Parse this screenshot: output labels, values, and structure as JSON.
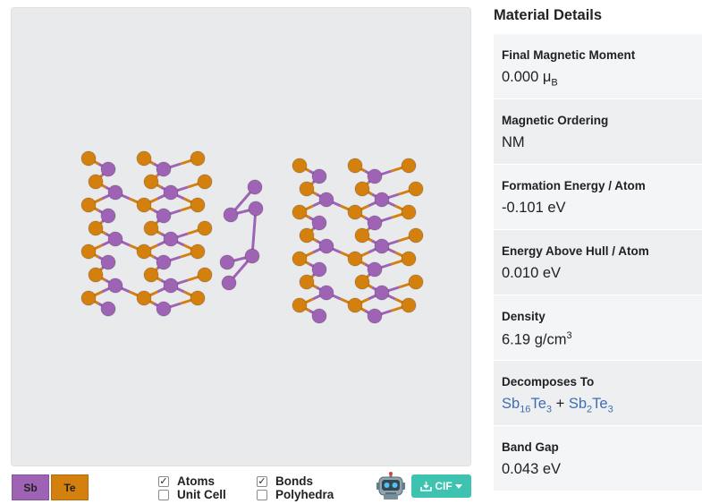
{
  "legend": {
    "sb": "Sb",
    "te": "Te"
  },
  "colors": {
    "sb": "#9e63b5",
    "te": "#d4800f",
    "cif_button": "#3ec3b1",
    "link": "#3f6eb3"
  },
  "toggles": {
    "atoms": {
      "label": "Atoms",
      "checked": true
    },
    "unit_cell": {
      "label": "Unit Cell",
      "checked": false
    },
    "bonds": {
      "label": "Bonds",
      "checked": true
    },
    "polyhedra": {
      "label": "Polyhedra",
      "checked": false
    }
  },
  "download": {
    "label": "CIF",
    "icon": "download-icon"
  },
  "robot_icon": "robot-icon",
  "details": {
    "title": "Material Details",
    "magnetic_moment": {
      "label": "Final Magnetic Moment",
      "value": "0.000",
      "unit": "μ",
      "unit_sub": "B"
    },
    "magnetic_ordering": {
      "label": "Magnetic Ordering",
      "value": "NM"
    },
    "formation_energy": {
      "label": "Formation Energy / Atom",
      "value": "-0.101 eV"
    },
    "energy_above_hull": {
      "label": "Energy Above Hull / Atom",
      "value": "0.010 eV"
    },
    "density": {
      "label": "Density",
      "value": "6.19 g/cm",
      "sup": "3"
    },
    "decomposes_to": {
      "label": "Decomposes To",
      "a_el1": "Sb",
      "a_n1": "16",
      "a_el2": "Te",
      "a_n2": "3",
      "plus": "+",
      "b_el1": "Sb",
      "b_n1": "2",
      "b_el2": "Te",
      "b_n2": "3"
    },
    "band_gap": {
      "label": "Band Gap",
      "value": "0.043 eV"
    }
  }
}
